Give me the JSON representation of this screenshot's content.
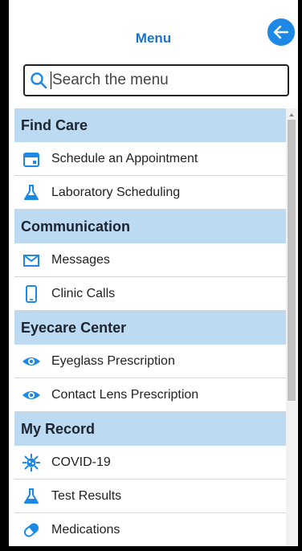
{
  "header": {
    "title": "Menu"
  },
  "search": {
    "placeholder": "Search the menu"
  },
  "sections": [
    {
      "label": "Find Care",
      "items": [
        {
          "label": "Schedule an Appointment",
          "icon": "calendar-icon"
        },
        {
          "label": "Laboratory Scheduling",
          "icon": "flask-icon"
        }
      ]
    },
    {
      "label": "Communication",
      "items": [
        {
          "label": "Messages",
          "icon": "envelope-icon"
        },
        {
          "label": "Clinic Calls",
          "icon": "phone-icon"
        }
      ]
    },
    {
      "label": "Eyecare Center",
      "items": [
        {
          "label": "Eyeglass Prescription",
          "icon": "eye-icon"
        },
        {
          "label": "Contact Lens Prescription",
          "icon": "eye-icon"
        }
      ]
    },
    {
      "label": "My Record",
      "items": [
        {
          "label": "COVID-19",
          "icon": "virus-icon"
        },
        {
          "label": "Test Results",
          "icon": "flask-icon"
        },
        {
          "label": "Medications",
          "icon": "pill-icon"
        }
      ]
    }
  ],
  "colors": {
    "accent": "#1e88e5",
    "section_bg": "#bcdaf2"
  }
}
